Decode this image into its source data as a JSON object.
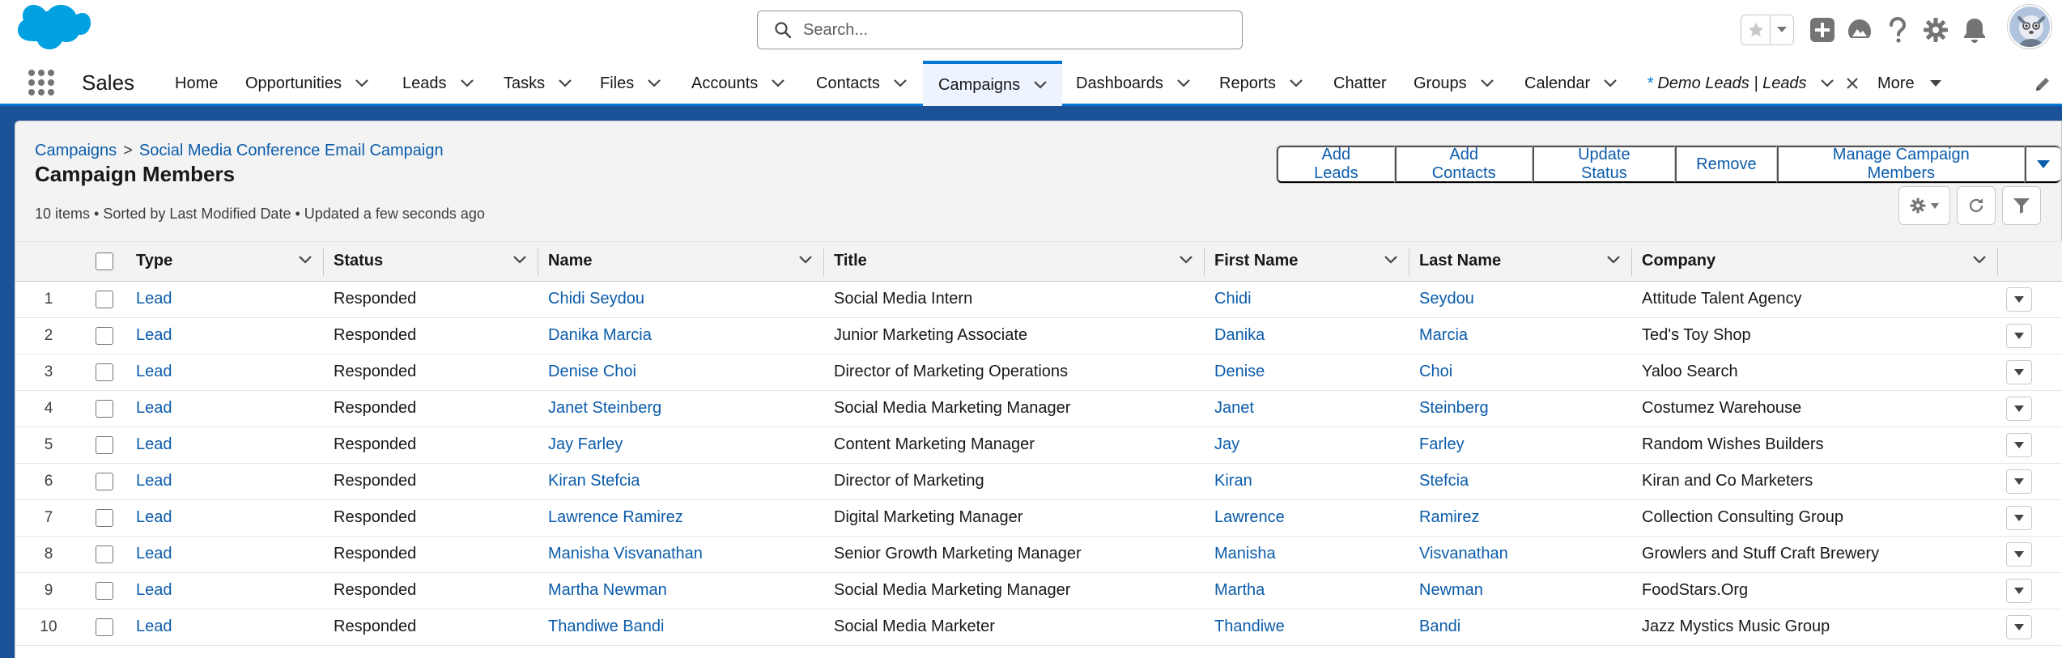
{
  "search": {
    "placeholder": "Search..."
  },
  "app": {
    "name": "Sales"
  },
  "nav": {
    "items": [
      {
        "label": "Home"
      },
      {
        "label": "Opportunities"
      },
      {
        "label": "Leads"
      },
      {
        "label": "Tasks"
      },
      {
        "label": "Files"
      },
      {
        "label": "Accounts"
      },
      {
        "label": "Contacts"
      },
      {
        "label": "Campaigns"
      },
      {
        "label": "Dashboards"
      },
      {
        "label": "Reports"
      },
      {
        "label": "Chatter"
      },
      {
        "label": "Groups"
      },
      {
        "label": "Calendar"
      },
      {
        "label": "Demo Leads | Leads",
        "unsaved_marker": "*"
      },
      {
        "label": "More"
      }
    ]
  },
  "breadcrumb": {
    "parent": "Campaigns",
    "separator": ">",
    "current": "Social Media Conference Email Campaign"
  },
  "page": {
    "title": "Campaign Members",
    "info": "10 items • Sorted by Last Modified Date • Updated a few seconds ago"
  },
  "actions": {
    "add_leads": "Add Leads",
    "add_contacts": "Add Contacts",
    "update_status": "Update Status",
    "remove": "Remove",
    "manage_members": "Manage Campaign Members"
  },
  "table": {
    "columns": {
      "type": "Type",
      "status": "Status",
      "name": "Name",
      "title": "Title",
      "first_name": "First Name",
      "last_name": "Last Name",
      "company": "Company"
    },
    "rows": [
      {
        "num": "1",
        "type": "Lead",
        "status": "Responded",
        "name": "Chidi Seydou",
        "title": "Social Media Intern",
        "first": "Chidi",
        "last": "Seydou",
        "company": "Attitude Talent Agency"
      },
      {
        "num": "2",
        "type": "Lead",
        "status": "Responded",
        "name": "Danika Marcia",
        "title": "Junior Marketing Associate",
        "first": "Danika",
        "last": "Marcia",
        "company": "Ted's Toy Shop"
      },
      {
        "num": "3",
        "type": "Lead",
        "status": "Responded",
        "name": "Denise Choi",
        "title": "Director of Marketing Operations",
        "first": "Denise",
        "last": "Choi",
        "company": "Yaloo Search"
      },
      {
        "num": "4",
        "type": "Lead",
        "status": "Responded",
        "name": "Janet Steinberg",
        "title": "Social Media Marketing Manager",
        "first": "Janet",
        "last": "Steinberg",
        "company": "Costumez Warehouse"
      },
      {
        "num": "5",
        "type": "Lead",
        "status": "Responded",
        "name": "Jay Farley",
        "title": "Content Marketing Manager",
        "first": "Jay",
        "last": "Farley",
        "company": "Random Wishes Builders"
      },
      {
        "num": "6",
        "type": "Lead",
        "status": "Responded",
        "name": "Kiran Stefcia",
        "title": "Director of Marketing",
        "first": "Kiran",
        "last": "Stefcia",
        "company": "Kiran and Co Marketers"
      },
      {
        "num": "7",
        "type": "Lead",
        "status": "Responded",
        "name": "Lawrence Ramirez",
        "title": "Digital Marketing Manager",
        "first": "Lawrence",
        "last": "Ramirez",
        "company": "Collection Consulting Group"
      },
      {
        "num": "8",
        "type": "Lead",
        "status": "Responded",
        "name": "Manisha Visvanathan",
        "title": "Senior Growth Marketing Manager",
        "first": "Manisha",
        "last": "Visvanathan",
        "company": "Growlers and Stuff Craft Brewery"
      },
      {
        "num": "9",
        "type": "Lead",
        "status": "Responded",
        "name": "Martha Newman",
        "title": "Social Media Marketing Manager",
        "first": "Martha",
        "last": "Newman",
        "company": "FoodStars.Org"
      },
      {
        "num": "10",
        "type": "Lead",
        "status": "Responded",
        "name": "Thandiwe Bandi",
        "title": "Social Media Marketer",
        "first": "Thandiwe",
        "last": "Bandi",
        "company": "Jazz Mystics Music Group"
      }
    ]
  },
  "colors": {
    "brand_blue": "#0176d3",
    "link_blue": "#0b5cab",
    "band_blue": "#1b5297",
    "logo_blue": "#00a1e0",
    "header_icon_gray": "#747474"
  },
  "icons": [
    "salesforce-cloud-logo",
    "search-icon",
    "star-icon",
    "chevron-down-icon",
    "add-icon",
    "trailhead-icon",
    "help-icon",
    "gear-icon",
    "bell-icon",
    "avatar",
    "app-launcher-icon",
    "close-icon",
    "pencil-icon",
    "refresh-icon",
    "filter-icon"
  ]
}
